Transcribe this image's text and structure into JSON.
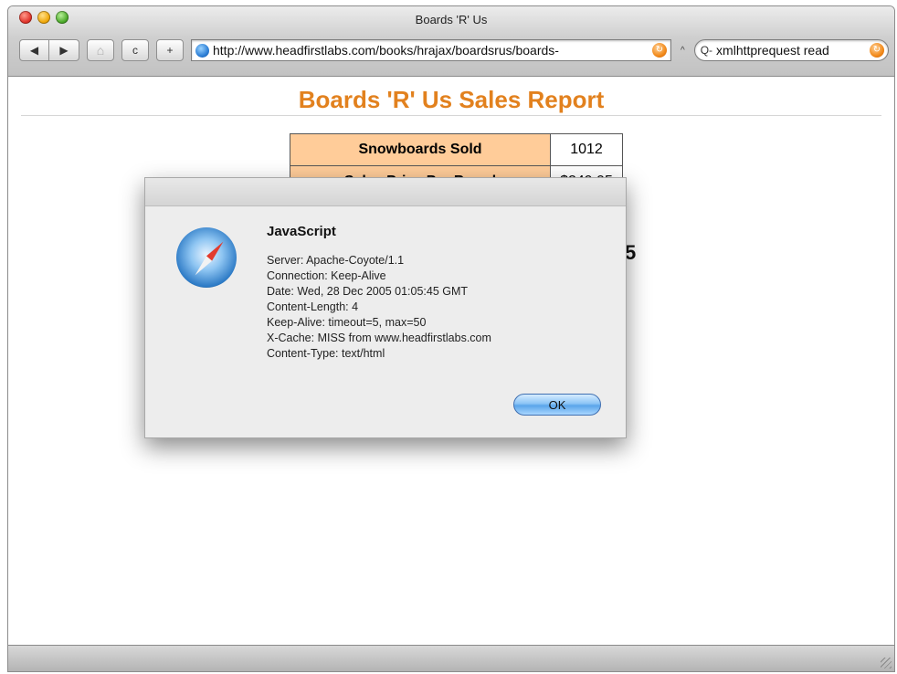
{
  "window": {
    "title": "Boards 'R' Us"
  },
  "toolbar": {
    "back_glyph": "◀",
    "forward_glyph": "▶",
    "home_glyph": "⌂",
    "reload_glyph": "c",
    "add_glyph": "+",
    "url": "http://www.headfirstlabs.com/books/hrajax/boardsrus/boards-",
    "search_text": "xmlhttprequest read",
    "search_icon_glyph": "Q-",
    "snapback_glyph": "^"
  },
  "page": {
    "title": "Boards 'R' Us Sales Report",
    "table": [
      {
        "label": "Snowboards Sold",
        "value": "1012"
      },
      {
        "label": "Sales Price Per Board",
        "value": "$249.95"
      }
    ],
    "partial_char": "5"
  },
  "dialog": {
    "title": "JavaScript",
    "lines": [
      "Server: Apache-Coyote/1.1",
      "Connection: Keep-Alive",
      "Date: Wed, 28 Dec 2005 01:05:45 GMT",
      "Content-Length: 4",
      "Keep-Alive: timeout=5, max=50",
      "X-Cache: MISS from www.headfirstlabs.com",
      "Content-Type: text/html"
    ],
    "ok_label": "OK"
  },
  "colors": {
    "title_orange": "#e2811e",
    "table_label_bg": "#ffcc99"
  }
}
